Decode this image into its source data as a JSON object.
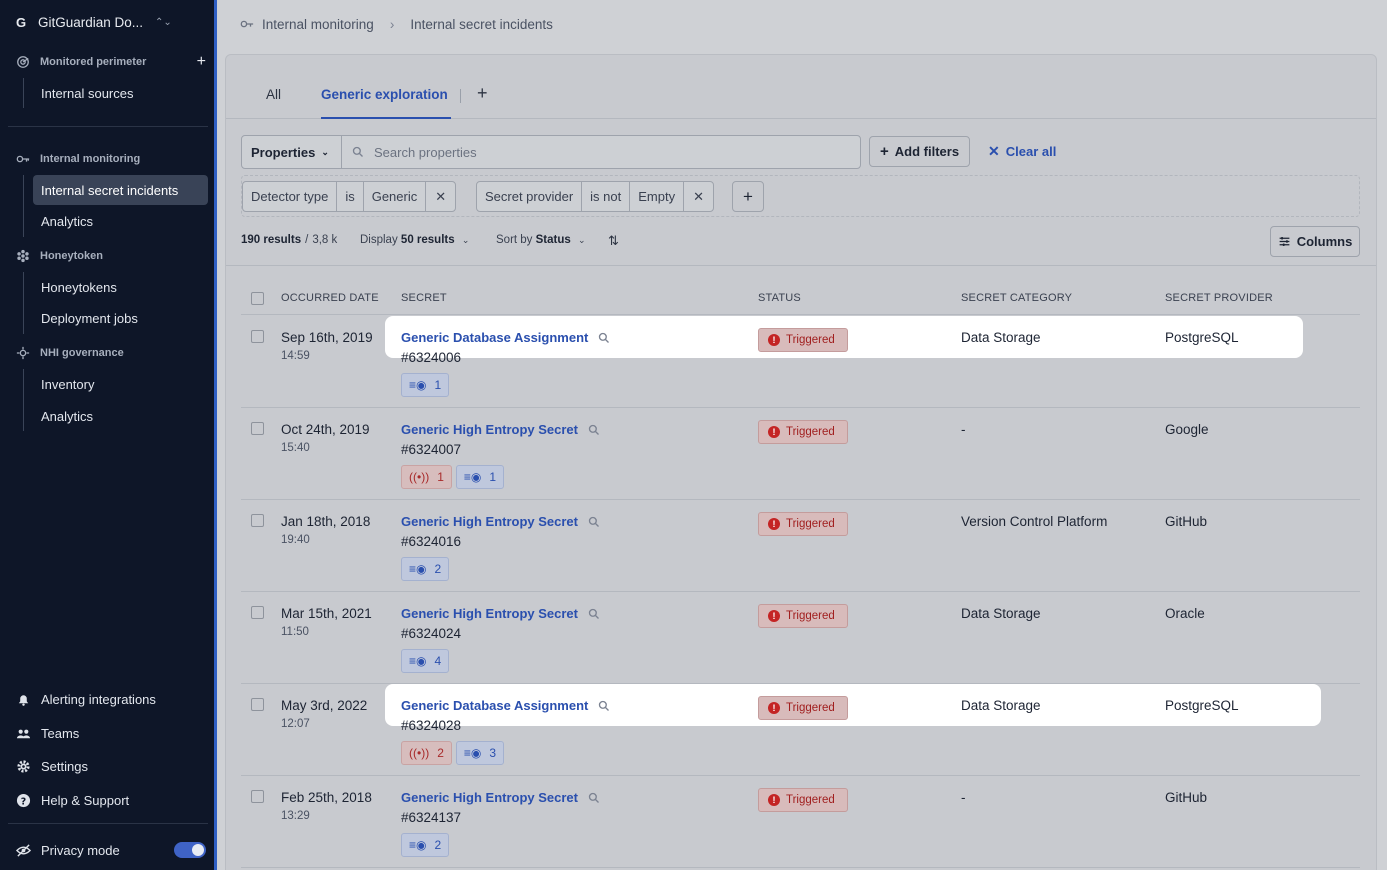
{
  "sidebar": {
    "workspace_initial": "G",
    "workspace_name": "GitGuardian Do...",
    "sections": {
      "monitored": "Monitored perimeter",
      "internal": "Internal monitoring",
      "honeytoken": "Honeytoken",
      "nhi": "NHI governance"
    },
    "items": {
      "internal_sources": "Internal sources",
      "internal_secret_incidents": "Internal secret incidents",
      "analytics_internal": "Analytics",
      "honeytokens": "Honeytokens",
      "deployment_jobs": "Deployment jobs",
      "inventory": "Inventory",
      "analytics_nhi": "Analytics"
    },
    "bottom": {
      "alerting": "Alerting integrations",
      "teams": "Teams",
      "settings": "Settings",
      "help": "Help & Support",
      "privacy": "Privacy mode"
    },
    "privacy_mode_on": true
  },
  "breadcrumb": {
    "parent": "Internal monitoring",
    "current": "Internal secret incidents"
  },
  "tabs": {
    "all": "All",
    "generic": "Generic exploration",
    "add": "+"
  },
  "filters": {
    "properties_label": "Properties",
    "search_placeholder": "Search properties",
    "add_filters": "Add filters",
    "clear_all": "Clear all",
    "chip1": {
      "field": "Detector type",
      "op": "is",
      "value": "Generic"
    },
    "chip2": {
      "field": "Secret provider",
      "op": "is not",
      "value": "Empty"
    }
  },
  "toolbar": {
    "results_count": "190 results",
    "results_total": "3,8 k",
    "display_label": "Display",
    "display_value": "50 results",
    "sort_label": "Sort by",
    "sort_value": "Status",
    "columns": "Columns"
  },
  "table": {
    "headers": {
      "date": "OCCURRED DATE",
      "secret": "SECRET",
      "status": "STATUS",
      "category": "SECRET CATEGORY",
      "provider": "SECRET PROVIDER"
    },
    "rows": [
      {
        "date": "Sep 16th, 2019",
        "time": "14:59",
        "name": "Generic Database Assignment",
        "id": "#6324006",
        "alerts": null,
        "views": "1",
        "status": "Triggered",
        "category": "Data Storage",
        "provider": "PostgreSQL"
      },
      {
        "date": "Oct 24th, 2019",
        "time": "15:40",
        "name": "Generic High Entropy Secret",
        "id": "#6324007",
        "alerts": "1",
        "views": "1",
        "status": "Triggered",
        "category": "-",
        "provider": "Google"
      },
      {
        "date": "Jan 18th, 2018",
        "time": "19:40",
        "name": "Generic High Entropy Secret",
        "id": "#6324016",
        "alerts": null,
        "views": "2",
        "status": "Triggered",
        "category": "Version Control Platform",
        "provider": "GitHub"
      },
      {
        "date": "Mar 15th, 2021",
        "time": "11:50",
        "name": "Generic High Entropy Secret",
        "id": "#6324024",
        "alerts": null,
        "views": "4",
        "status": "Triggered",
        "category": "Data Storage",
        "provider": "Oracle"
      },
      {
        "date": "May 3rd, 2022",
        "time": "12:07",
        "name": "Generic Database Assignment",
        "id": "#6324028",
        "alerts": "2",
        "views": "3",
        "status": "Triggered",
        "category": "Data Storage",
        "provider": "PostgreSQL"
      },
      {
        "date": "Feb 25th, 2018",
        "time": "13:29",
        "name": "Generic High Entropy Secret",
        "id": "#6324137",
        "alerts": null,
        "views": "2",
        "status": "Triggered",
        "category": "-",
        "provider": "GitHub"
      }
    ]
  },
  "colors": {
    "accent": "#2a4fae",
    "sidebar_bg": "#0e1628",
    "triggered": "#c42424"
  }
}
